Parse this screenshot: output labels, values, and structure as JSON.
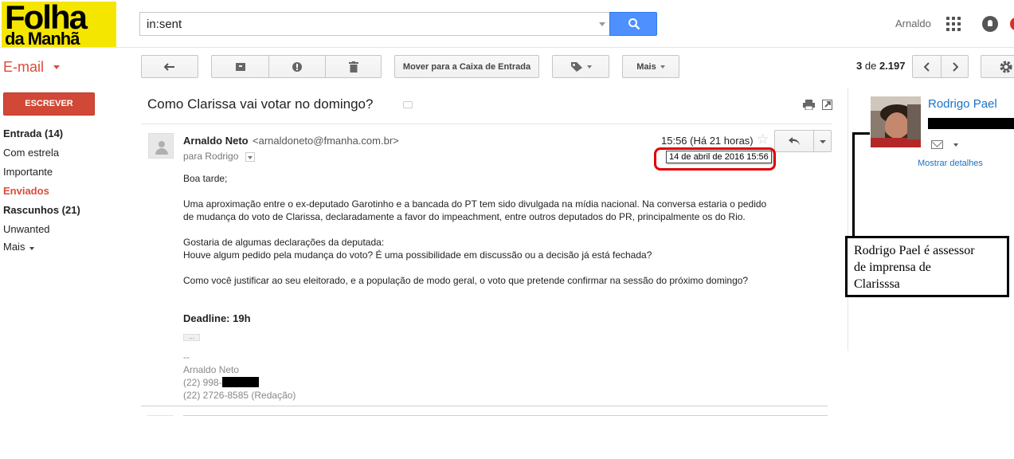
{
  "logo": {
    "line1": "Folha",
    "line2": "da Manhã"
  },
  "search": {
    "value": "in:sent"
  },
  "header": {
    "user_name": "Arnaldo"
  },
  "toolbar": {
    "app_label": "E-mail",
    "move_inbox_label": "Mover para a Caixa de Entrada",
    "more_label": "Mais",
    "page_current": "3",
    "page_of": "de",
    "page_total": "2.197"
  },
  "sidebar": {
    "compose_label": "ESCREVER",
    "items": [
      {
        "label": "Entrada (14)"
      },
      {
        "label": "Com estrela"
      },
      {
        "label": "Importante"
      },
      {
        "label": "Enviados"
      },
      {
        "label": "Rascunhos (21)"
      },
      {
        "label": "Unwanted"
      },
      {
        "label": "Mais"
      }
    ]
  },
  "message": {
    "subject": "Como Clarissa vai votar no domingo?",
    "sender_name": "Arnaldo Neto",
    "sender_email": "<arnaldoneto@fmanha.com.br>",
    "to_line": "para Rodrigo",
    "time": "15:56 (Há 21 horas)",
    "date_tooltip": "14 de abril de 2016 15:56",
    "body": [
      "Boa tarde;",
      "Uma aproximação entre o ex-deputado Garotinho e a bancada do PT tem sido divulgada na mídia nacional. Na conversa estaria o pedido",
      "de mudança do voto de Clarissa, declaradamente a favor do impeachment, entre outros deputados do PR, principalmente os do Rio.",
      "Gostaria de algumas declarações da deputada:",
      "Houve algum pedido pela mudança do voto? É uma possibilidade em discussão ou a decisão já está fechada?",
      "Como você justificar ao seu eleitorado, e a população de modo geral, o voto que pretende confirmar na sessão do próximo domingo?"
    ],
    "deadline": "Deadline: 19h",
    "ellipsis": "...",
    "signature": [
      "--",
      "Arnaldo Neto",
      "(22) 998-",
      "(22) 2726-8585 (Redação)"
    ]
  },
  "contact": {
    "name": "Rodrigo Pael",
    "details_link": "Mostrar detalhes"
  },
  "annotation": {
    "lines": [
      "Rodrigo Pael é assessor",
      "de imprensa de",
      "Clarisssa"
    ]
  },
  "colors": {
    "accent_red": "#dd4b39",
    "compose_red": "#d14836",
    "search_blue": "#4d90fe",
    "link_blue": "#1a73c8",
    "highlight_ring": "#e00000",
    "logo_yellow": "#f5e600"
  }
}
